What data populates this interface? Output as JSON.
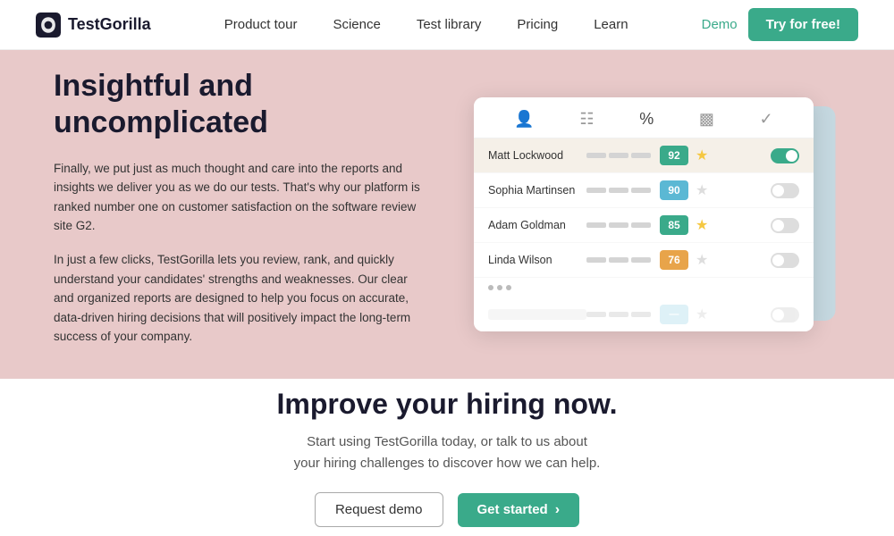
{
  "nav": {
    "logo_text": "TestGorilla",
    "links": [
      {
        "label": "Product tour",
        "id": "product-tour"
      },
      {
        "label": "Science",
        "id": "science"
      },
      {
        "label": "Test library",
        "id": "test-library"
      },
      {
        "label": "Pricing",
        "id": "pricing"
      },
      {
        "label": "Learn",
        "id": "learn"
      }
    ],
    "demo_label": "Demo",
    "cta_label": "Try for free!"
  },
  "hero": {
    "title": "Insightful and uncomplicated",
    "para1": "Finally, we put just as much thought and care into the reports and insights we deliver you as we do our tests. That's why our platform is ranked number one on customer satisfaction on the software review site G2.",
    "para2": "In just a few clicks, TestGorilla lets you review, rank, and quickly understand your candidates' strengths and weaknesses. Our clear and organized reports are designed to help you focus on accurate, data-driven hiring decisions that will positively impact the long-term success of your company."
  },
  "card": {
    "rows": [
      {
        "name": "Matt Lockwood",
        "score": "92",
        "score_class": "score-green",
        "star": "filled",
        "toggle": "on",
        "highlighted": true
      },
      {
        "name": "Sophia Martinsen",
        "score": "90",
        "score_class": "score-teal",
        "star": "empty",
        "toggle": "off",
        "highlighted": false
      },
      {
        "name": "Adam Goldman",
        "score": "85",
        "score_class": "score-green",
        "star": "filled",
        "toggle": "off",
        "highlighted": false
      },
      {
        "name": "Linda Wilson",
        "score": "76",
        "score_class": "score-orange",
        "star": "empty",
        "toggle": "off",
        "highlighted": false
      }
    ]
  },
  "bottom": {
    "title": "Improve your hiring now.",
    "subtitle": "Start using TestGorilla today, or talk to us about\nyour hiring challenges to discover how we can help.",
    "btn_outline_label": "Request demo",
    "btn_filled_label": "Get started",
    "btn_arrow": "›"
  }
}
